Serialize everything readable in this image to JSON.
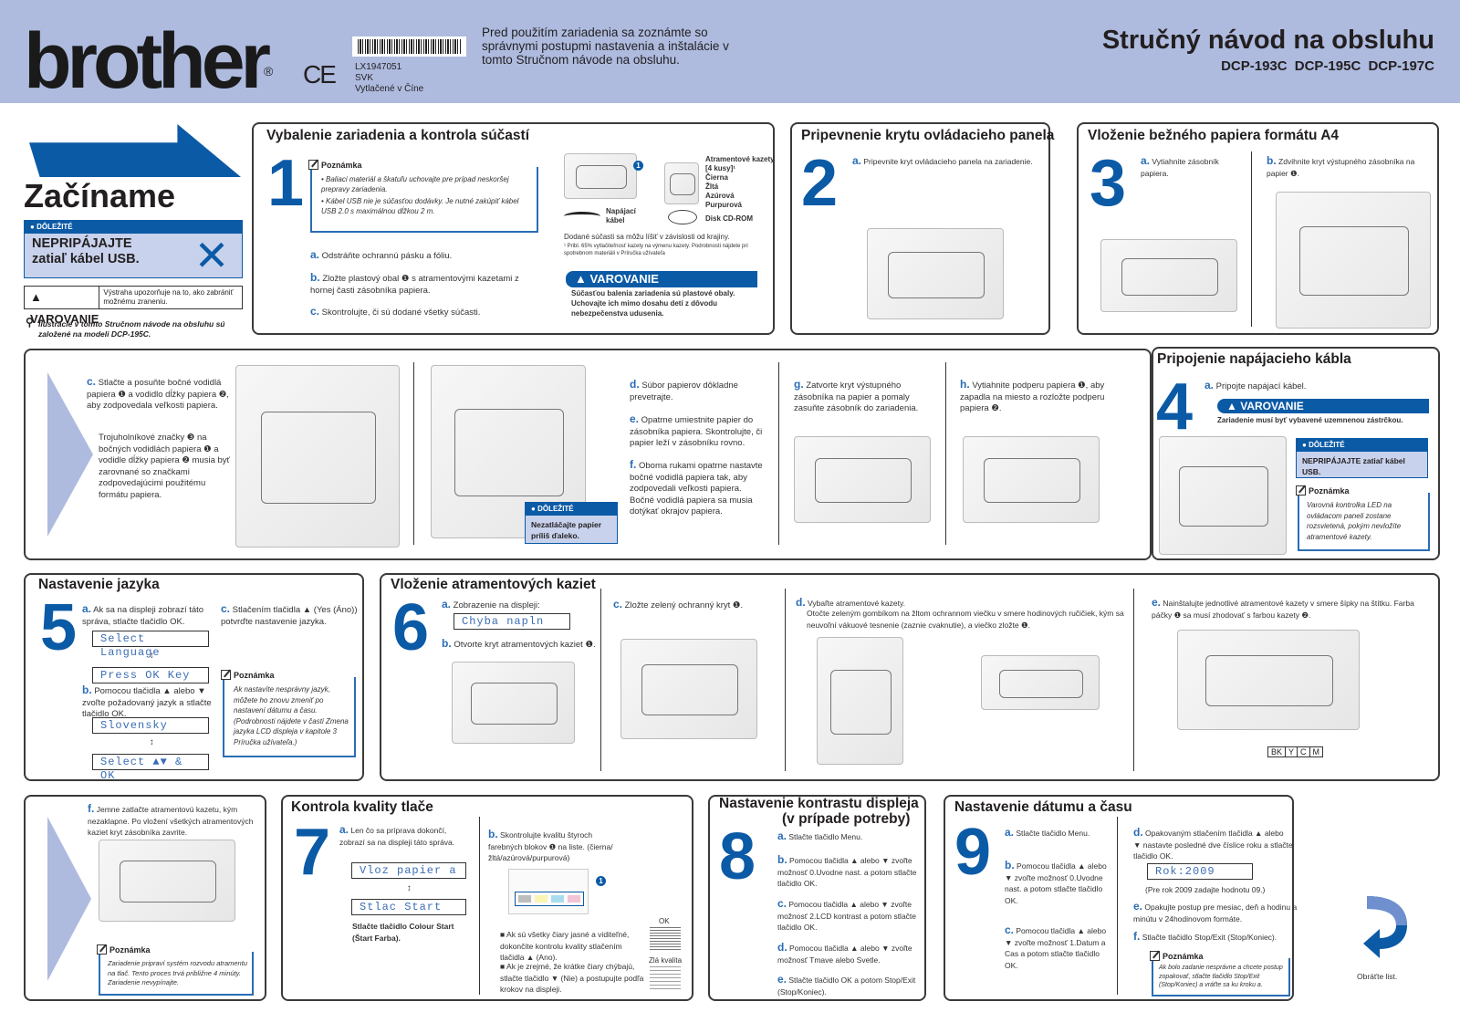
{
  "header": {
    "logo": "brother",
    "registered": "®",
    "ce_mark": "CE",
    "barcode_code": "LX1947051",
    "barcode_lang": "SVK",
    "barcode_print": "Vytlačené v Číne",
    "intro": "Pred použitím zariadenia sa zoznámte so správnymi postupmi nastavenia a inštalácie v tomto Stručnom návode na obsluhu.",
    "title": "Stručný návod na obsluhu",
    "models": "DCP-193C  DCP-195C  DCP-197C"
  },
  "start": {
    "title": "Začíname",
    "important_label": "DÔLEŽITÉ",
    "important_text": "NEPRIPÁJAJTE zatiaľ kábel USB.",
    "warning_label": "VAROVANIE",
    "warning_desc": "Výstraha upozorňuje na to, ako zabrániť možnému zraneniu.",
    "illustration_note": "Ilustrácie v tomto Stručnom návode na obsluhu sú založené na modeli DCP-195C."
  },
  "s1": {
    "title": "Vybalenie zariadenia a kontrola súčastí",
    "num": "1",
    "note_label": "Poznámka",
    "note1": "• Baliaci materiál a škatuľu uchovajte pre prípad neskoršej prepravy zariadenia.",
    "note2": "• Kábel USB nie je súčasťou dodávky. Je nutné zakúpiť kábel USB 2.0 s maximálnou dĺžkou 2 m.",
    "a": "Odstráňte ochrannú pásku a fóliu.",
    "b": "Zložte plastový obal ❶ s atramentovými kazetami z hornej časti zásobníka papiera.",
    "c": "Skontrolujte, či sú dodané všetky súčasti.",
    "cart": "Atramentové kazety [4 kusy]¹",
    "cart_colors": [
      "Čierna",
      "Žltá",
      "Azúrová",
      "Purpurová"
    ],
    "cable": "Napájací kábel",
    "cd": "Disk CD-ROM",
    "vary": "Dodané súčasti sa môžu líšiť v závislosti od krajiny.",
    "footnote": "¹ Pribl. 65% vytlačiteľnosť kazety na výmenu kazety. Podrobnosti nájdete pri spotrebnom materiáli v Príručka užívateľa",
    "warn_label": "VAROVANIE",
    "warn_text": "Súčasťou balenia zariadenia sú plastové obaly. Uchovajte ich mimo dosahu detí z dôvodu nebezpečenstva udusenia."
  },
  "s2": {
    "title": "Pripevnenie krytu ovládacieho panela",
    "num": "2",
    "a": "Pripevnite kryt ovládacieho panela na zariadenie."
  },
  "s3": {
    "title": "Vloženie bežného papiera formátu A4",
    "num": "3",
    "a": "Vytiahnite zásobník papiera.",
    "b": "Zdvihnite kryt výstupného zásobníka na papier ❶.",
    "c": "Stlačte a posuňte bočné vodidlá papiera ❶ a vodidlo dĺžky papiera ❷, aby zodpovedala veľkosti papiera.",
    "c2": "Trojuholníkové značky ❸ na bočných vodidlách papiera ❶ a vodidle dĺžky papiera ❷ musia byť zarovnané so značkami zodpovedajúcimi použitému formátu papiera.",
    "d": "Súbor papierov dôkladne prevetrajte.",
    "e": "Opatrne umiestnite papier do zásobníka papiera. Skontrolujte, či papier leží v zásobníku rovno.",
    "f": "Oboma rukami opatrne nastavte bočné vodidlá papiera tak, aby zodpovedali veľkosti papiera. Bočné vodidlá papiera sa musia dotýkať okrajov papiera.",
    "g": "Zatvorte kryt výstupného zásobníka na papier a pomaly zasuňte zásobník do zariadenia.",
    "h": "Vytiahnite podperu papiera ❶, aby zapadla na miesto a rozložte podperu papiera ❷.",
    "imp_label": "DÔLEŽITÉ",
    "imp_text": "Nezatláčajte papier príliš ďaleko."
  },
  "s4": {
    "title": "Pripojenie napájacieho kábla",
    "num": "4",
    "a": "Pripojte napájací kábel.",
    "warn_label": "VAROVANIE",
    "warn_text": "Zariadenie musí byť vybavené uzemnenou zástrčkou.",
    "imp_label": "DÔLEŽITÉ",
    "imp_text": "NEPRIPÁJAJTE zatiaľ kábel USB.",
    "note_label": "Poznámka",
    "note_text": "Varovná kontrolka LED na ovládacom paneli zostane rozsvietená, pokým nevložíte atramentové kazety."
  },
  "s5": {
    "title": "Nastavenie jazyka",
    "num": "5",
    "a": "Ak sa na displeji zobrazí táto správa, stlačte tlačidlo OK.",
    "lcd1": "Select Language",
    "lcd2": "Press OK Key",
    "b": "Pomocou tlačidla ▲ alebo ▼ zvoľte požadovaný jazyk a stlačte tlačidlo OK.",
    "lcd3": "Slovensky",
    "lcd4": "Select ▲▼ & OK",
    "c": "Stlačením tlačidla ▲ (Yes (Áno)) potvrďte nastavenie jazyka.",
    "note_label": "Poznámka",
    "note_text": "Ak nastavíte nesprávny jazyk, môžete ho znovu zmeniť po nastavení dátumu a času. (Podrobnosti nájdete v časti Zmena jazyka LCD displeja v kapitole 3 Príručka užívateľa.)"
  },
  "s6": {
    "title": "Vloženie atramentových kaziet",
    "num": "6",
    "a": "Zobrazenie na displeji:",
    "lcd1": "Chyba napln",
    "b": "Otvorte kryt atramentových kaziet ❶.",
    "c": "Zložte zelený ochranný kryt ❶.",
    "d": "Vybaľte atramentové kazety.",
    "d2": "Otočte zeleným gombíkom na žltom ochrannom viečku v smere hodinových ručičiek, kým sa neuvoľní vákuové tesnenie (zaznie cvaknutie), a viečko zložte ❶.",
    "e": "Nainštalujte jednotlivé atramentové kazety v smere šípky na štítku. Farba páčky ❶ sa musí zhodovať s farbou kazety ❷.",
    "ink_labels": [
      "BK",
      "Y",
      "C",
      "M"
    ],
    "f": "Jemne zatlačte atramentovú kazetu, kým nezaklapne. Po vložení všetkých atramentových kaziet kryt zásobníka zavrite.",
    "note_label": "Poznámka",
    "note_text": "Zariadenie pripraví systém rozvodu atramentu na tlač. Tento proces trvá približne 4 minúty. Zariadenie nevypínajte."
  },
  "s7": {
    "title": "Kontrola kvality tlače",
    "num": "7",
    "a": "Len čo sa príprava dokončí, zobrazí sa na displeji táto správa.",
    "lcd1": "Vloz papier a",
    "lcd2": "Stlac Start",
    "a2": "Stlačte tlačidlo Colour Start (Štart Farba).",
    "b": "Skontrolujte kvalitu štyroch farebných blokov ❶ na liste. (čierna/žltá/azúrová/purpurová)",
    "b1": "Ak sú všetky čiary jasné a viditeľné, dokončite kontrolu kvality stlačením tlačidla ▲ (Ano).",
    "b2": "Ak je zrejmé, že krátke čiary chýbajú, stlačte tlačidlo ▼ (Nie) a postupujte podľa krokov na displeji.",
    "ok": "OK",
    "bad": "Zlá kvalita"
  },
  "s8": {
    "title": "Nastavenie kontrastu displeja",
    "subtitle": "(v prípade potreby)",
    "num": "8",
    "a": "Stlačte tlačidlo Menu.",
    "b": "Pomocou tlačidla ▲ alebo ▼ zvoľte možnosť 0.Uvodne nast. a potom stlačte tlačidlo OK.",
    "c": "Pomocou tlačidla ▲ alebo ▼ zvoľte možnosť 2.LCD kontrast a potom stlačte tlačidlo OK.",
    "d": "Pomocou tlačidla ▲ alebo ▼ zvoľte možnosť Tmave alebo Svetle.",
    "e": "Stlačte tlačidlo OK a potom Stop/Exit (Stop/Koniec)."
  },
  "s9": {
    "title": "Nastavenie dátumu a času",
    "num": "9",
    "a": "Stlačte tlačidlo Menu.",
    "b": "Pomocou tlačidla ▲ alebo ▼ zvoľte možnosť 0.Uvodne nast. a potom stlačte tlačidlo OK.",
    "c": "Pomocou tlačidla ▲ alebo ▼ zvoľte možnosť 1.Datum a Cas a potom stlačte tlačidlo OK.",
    "d": "Opakovaným stlačením tlačidla ▲ alebo ▼ nastavte posledné dve číslice roku a stlačte tlačidlo OK.",
    "lcd1": "Rok:2009",
    "d2": "(Pre rok 2009 zadajte hodnotu 09.)",
    "e": "Opakujte postup pre mesiac, deň a hodinu a minútu v 24hodinovom formáte.",
    "f": "Stlačte tlačidlo Stop/Exit (Stop/Koniec).",
    "note_label": "Poznámka",
    "note_text": "Ak bolo zadanie nesprávne a chcete postup zopakovať, stlačte tlačidlo Stop/Exit (Stop/Koniec) a vráťte sa ku kroku a."
  },
  "turn": {
    "label": "Obráťte list."
  },
  "letters": {
    "a": "a.",
    "b": "b.",
    "c": "c.",
    "d": "d.",
    "e": "e.",
    "f": "f.",
    "g": "g.",
    "h": "h."
  }
}
